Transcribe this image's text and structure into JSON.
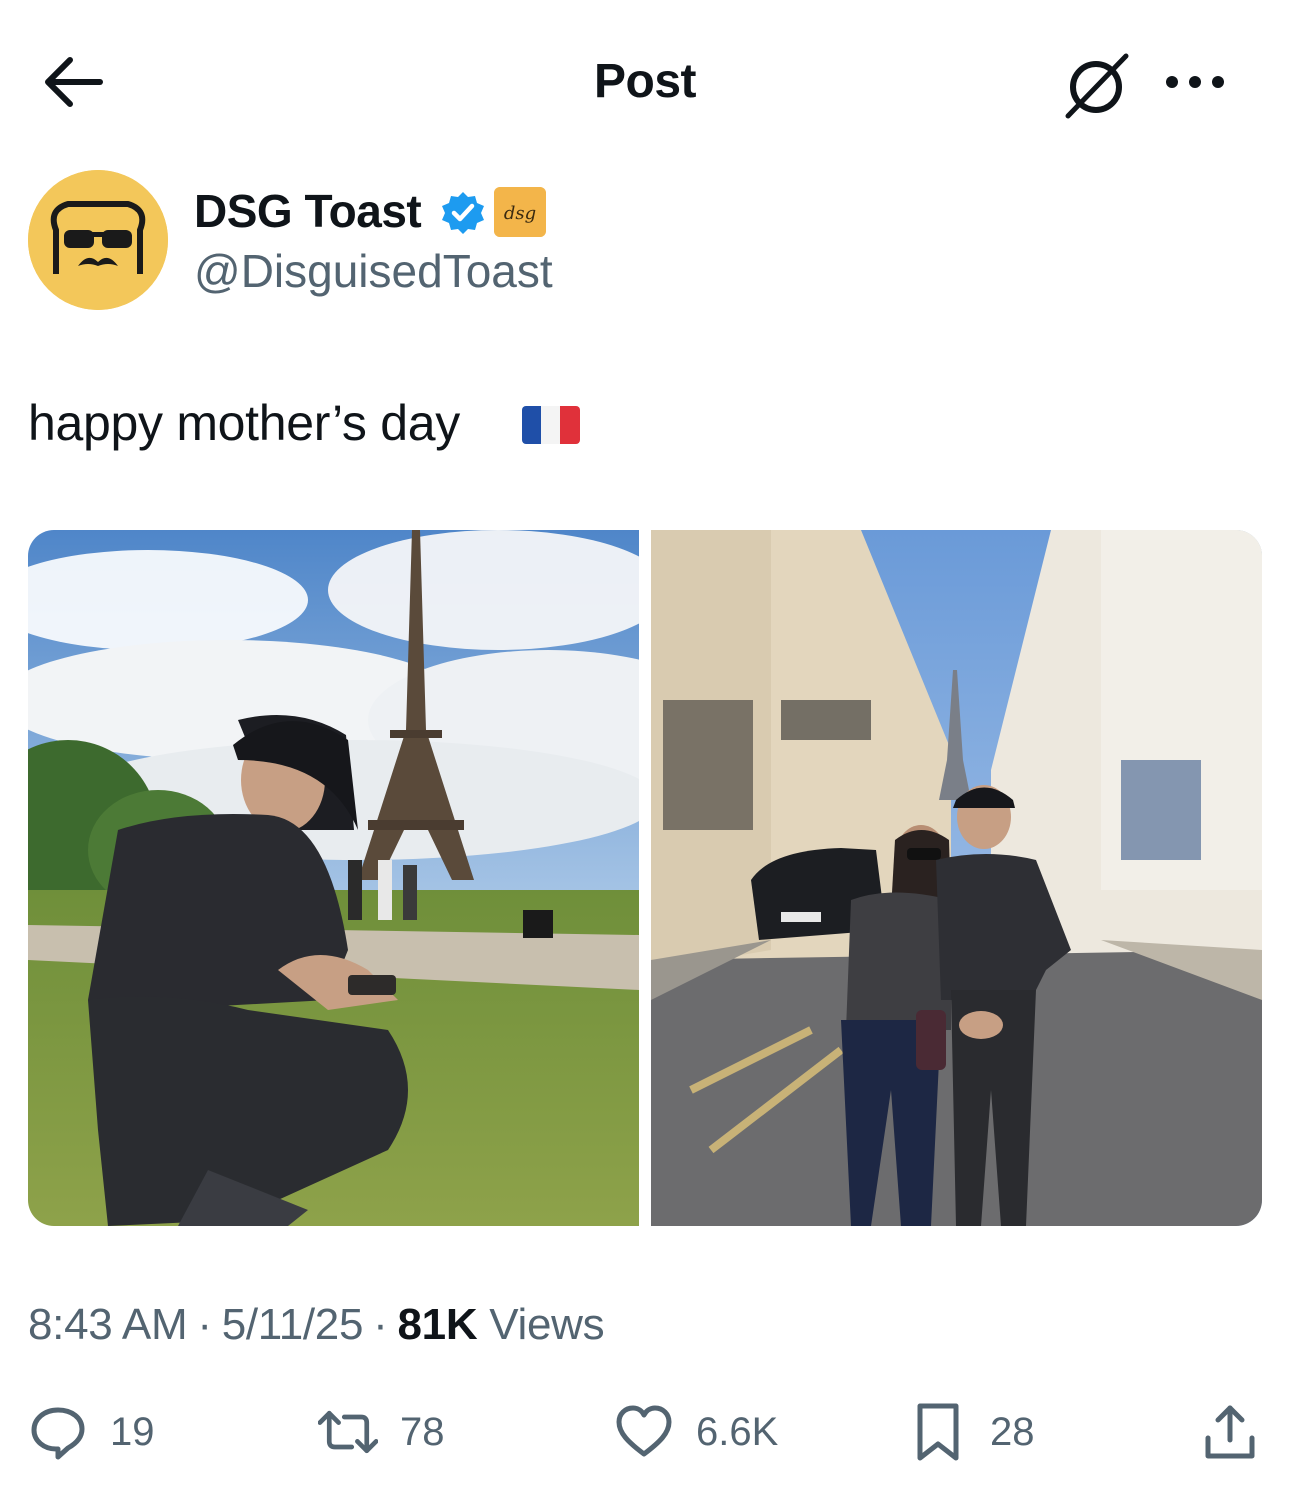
{
  "header": {
    "title": "Post",
    "icons": {
      "back": "arrow-left-icon",
      "grok": "grok-icon",
      "more": "more-horizontal-icon"
    }
  },
  "author": {
    "display_name": "DSG Toast",
    "handle": "@DisguisedToast",
    "verified": true,
    "affiliate_badge_text": "dsg",
    "avatar": "toast-with-sunglasses-mustache"
  },
  "post": {
    "text": "happy mother’s day",
    "flag": "france-flag-icon"
  },
  "media": {
    "photos": [
      {
        "name": "photo-eiffel-tower-crouching"
      },
      {
        "name": "photo-street-with-mother"
      }
    ]
  },
  "meta": {
    "time": "8:43 AM",
    "sep1": "·",
    "date": "5/11/25",
    "sep2": "·",
    "views_count": "81K",
    "views_label": "Views"
  },
  "actions": {
    "reply": {
      "icon": "reply-icon",
      "count": "19"
    },
    "repost": {
      "icon": "repost-icon",
      "count": "78"
    },
    "like": {
      "icon": "heart-icon",
      "count": "6.6K"
    },
    "bookmark": {
      "icon": "bookmark-icon",
      "count": "28"
    },
    "share": {
      "icon": "share-icon"
    }
  },
  "colors": {
    "text_primary": "#0f1419",
    "text_secondary": "#536471",
    "verified_blue": "#1d9bf0",
    "avatar_yellow": "#f3c75a"
  }
}
